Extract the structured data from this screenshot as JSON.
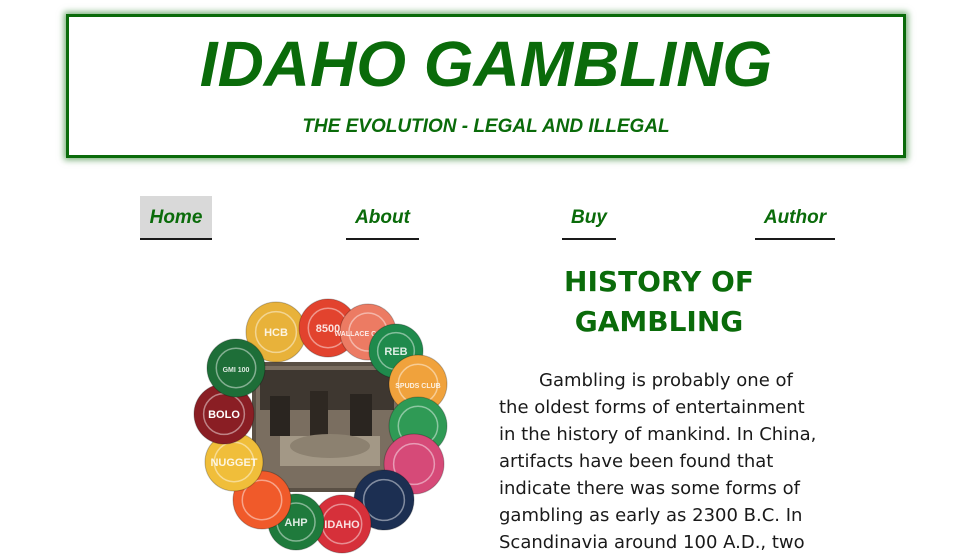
{
  "header": {
    "title": "IDAHO GAMBLING",
    "subtitle": "THE EVOLUTION - LEGAL AND ILLEGAL"
  },
  "nav": {
    "items": [
      {
        "label": "Home",
        "active": true
      },
      {
        "label": "About",
        "active": false
      },
      {
        "label": "Buy",
        "active": false
      },
      {
        "label": "Author",
        "active": false
      }
    ]
  },
  "colors": {
    "brand_green": "#0a6b0a",
    "active_tab_bg": "#d9d9d9"
  },
  "image": {
    "chips": [
      {
        "label": "HCB",
        "color": "#e8b23a"
      },
      {
        "label": "8500",
        "color": "#e2432e"
      },
      {
        "label": "WALLACE CORNER",
        "color": "#ec7b63"
      },
      {
        "label": "REB",
        "color": "#1f8a4c"
      },
      {
        "label": "SPUDS CLUB",
        "color": "#f0a23c"
      },
      {
        "label": "",
        "color": "#2f9a55"
      },
      {
        "label": "",
        "color": "#d64a78"
      },
      {
        "label": "",
        "color": "#1c2f52"
      },
      {
        "label": "IDAHO",
        "color": "#d6303a"
      },
      {
        "label": "AHP",
        "color": "#1f7a3c"
      },
      {
        "label": "",
        "color": "#f05a2a"
      },
      {
        "label": "NUGGET",
        "color": "#f0be3a"
      },
      {
        "label": "BOLO",
        "color": "#8a1e24"
      },
      {
        "label": "GMI 100",
        "color": "#1e6e38"
      }
    ]
  },
  "article": {
    "title": "HISTORY OF GAMBLING",
    "body": "Gambling is probably one of the oldest forms of entertainment in the history of mankind. In China, artifacts have been found that indicate there was some forms of gambling as early as 2300 B.C. In Scandinavia around 100 A.D., two"
  }
}
